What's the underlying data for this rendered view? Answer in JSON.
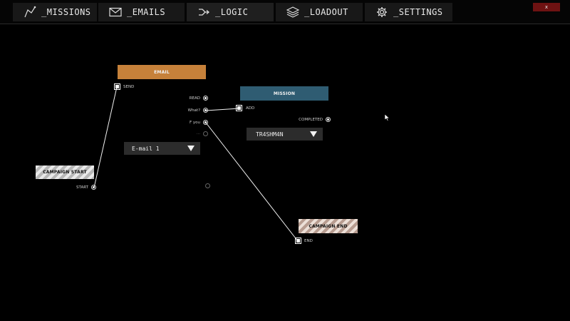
{
  "nav": {
    "tabs": [
      {
        "label": "_MISSIONS",
        "icon": "missions-icon"
      },
      {
        "label": "_EMAILS",
        "icon": "envelope-icon"
      },
      {
        "label": "_LOGIC",
        "icon": "logic-flow-icon"
      },
      {
        "label": "_LOADOUT",
        "icon": "layers-icon"
      },
      {
        "label": "_SETTINGS",
        "icon": "gear-icon"
      }
    ],
    "active_tab": "_LOGIC",
    "close_label": "x"
  },
  "nodes": {
    "email": {
      "title": "EMAIL",
      "in_port": "SEND",
      "out_ports": [
        "READ",
        "What?",
        "F you",
        "..."
      ],
      "dropdown_value": "E-mail 1"
    },
    "mission": {
      "title": "MISSION",
      "in_port": "ADD",
      "out_port": "COMPLETED",
      "dropdown_value": "TR4SHM4N"
    },
    "campaign_start": {
      "title": "CAMPAIGN START",
      "out_port": "START"
    },
    "campaign_end": {
      "title": "CAMPAIGN END",
      "in_port": "END"
    }
  },
  "colors": {
    "email_header": "#c6813a",
    "mission_header": "#2f5c72",
    "close_button": "#6e1212",
    "background": "#000000"
  }
}
